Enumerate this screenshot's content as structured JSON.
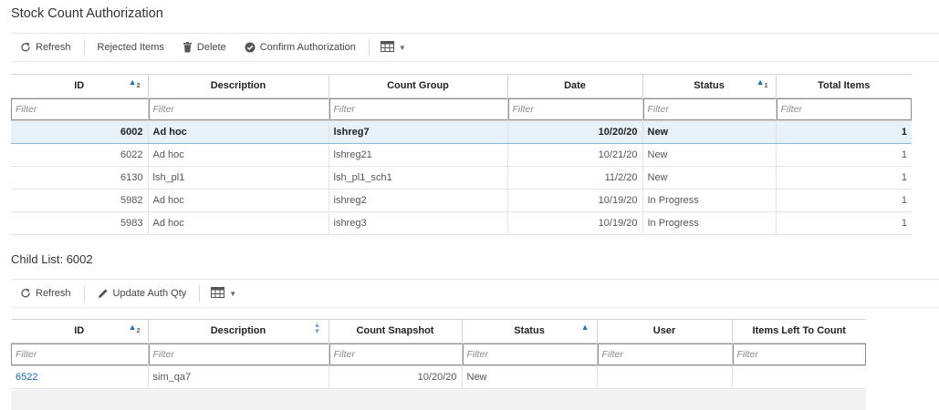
{
  "page": {
    "title": "Stock Count Authorization"
  },
  "toolbar": {
    "refresh": "Refresh",
    "rejected": "Rejected Items",
    "delete": "Delete",
    "confirm": "Confirm Authorization"
  },
  "main_grid": {
    "columns": [
      "ID",
      "Description",
      "Count Group",
      "Date",
      "Status",
      "Total Items"
    ],
    "filter_placeholder": "Filter",
    "rows": [
      {
        "id": "6002",
        "description": "Ad hoc",
        "group": "lshreg7",
        "date": "10/20/20",
        "status": "New",
        "total": "1"
      },
      {
        "id": "6022",
        "description": "Ad hoc",
        "group": "lshreg21",
        "date": "10/21/20",
        "status": "New",
        "total": "1"
      },
      {
        "id": "6130",
        "description": "lsh_pl1",
        "group": "lsh_pl1_sch1",
        "date": "11/2/20",
        "status": "New",
        "total": "1"
      },
      {
        "id": "5982",
        "description": "Ad hoc",
        "group": "ishreg2",
        "date": "10/19/20",
        "status": "In Progress",
        "total": "1"
      },
      {
        "id": "5983",
        "description": "Ad hoc",
        "group": "ishreg3",
        "date": "10/19/20",
        "status": "In Progress",
        "total": "1"
      }
    ],
    "sort_id_order": "2",
    "sort_status_order": "1"
  },
  "child": {
    "title": "Child List: 6002",
    "toolbar": {
      "refresh": "Refresh",
      "update": "Update Auth Qty"
    },
    "columns": [
      "ID",
      "Description",
      "Count Snapshot",
      "Status",
      "User",
      "Items Left To Count"
    ],
    "sort_id_order": "2",
    "rows": [
      {
        "id": "6522",
        "description": "sim_qa7",
        "snapshot": "10/20/20",
        "status": "New",
        "user": "",
        "items_left": ""
      }
    ]
  },
  "colors": {
    "accent": "#1f73b7",
    "selected_row": "#e7f1f9",
    "link": "#1f67b1"
  },
  "icons": [
    "refresh-icon",
    "trash-icon",
    "check-circle-icon",
    "table-columns-icon",
    "pencil-icon",
    "sort-asc-icon",
    "sort-both-icon"
  ]
}
